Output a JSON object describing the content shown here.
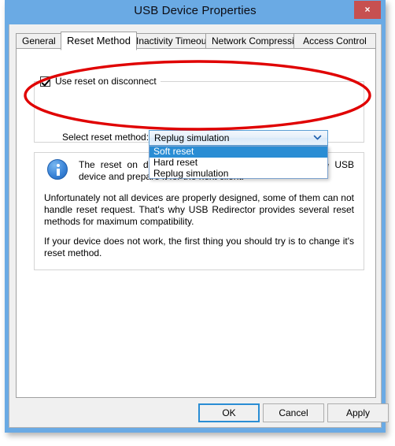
{
  "window": {
    "title": "USB Device Properties",
    "close_label": "×",
    "titlebar_color": "#6aaae4",
    "close_button_color": "#c75050"
  },
  "tabs": [
    {
      "label": "General",
      "active": false
    },
    {
      "label": "Reset Method",
      "active": true
    },
    {
      "label": "Inactivity Timeout",
      "active": false
    },
    {
      "label": "Network Compression",
      "active": false
    },
    {
      "label": "Access Control List",
      "active": false
    }
  ],
  "reset_method_tab": {
    "checkbox": {
      "label": "Use reset on disconnect",
      "checked": true
    },
    "combo": {
      "label": "Select reset method:",
      "value": "Replug simulation",
      "expanded": true,
      "options": [
        {
          "label": "Soft reset",
          "highlighted": true
        },
        {
          "label": "Hard reset",
          "highlighted": false
        },
        {
          "label": "Replug simulation",
          "highlighted": false
        }
      ],
      "arrow_icon": "chevron-down-icon",
      "highlight_color": "#2a8dd4"
    },
    "info": {
      "icon": "info-icon",
      "paragraph_1": "The reset on disconnect feature helps to reinitalize the USB device and prepare it for the next client.",
      "paragraph_2": "Unfortunately not all devices are properly designed, some of them can not handle reset request. That's why USB Redirector provides several reset methods for maximum compatibility.",
      "paragraph_3": "If your device does not work, the first thing you should try is to change it's reset method."
    }
  },
  "buttons": {
    "ok": "OK",
    "cancel": "Cancel",
    "apply": "Apply"
  },
  "annotation": {
    "shape": "ellipse",
    "color": "#e00000"
  }
}
